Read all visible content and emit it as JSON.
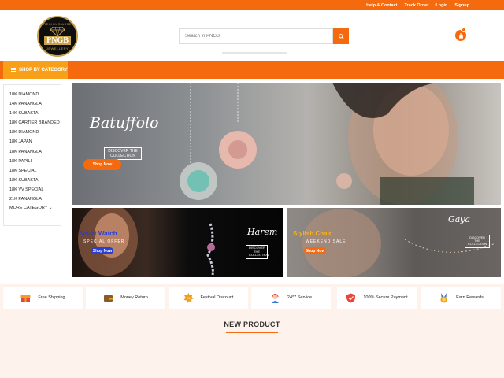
{
  "topbar": {
    "links": [
      "Help & Contact",
      "Track Order",
      "Login",
      "Signup"
    ]
  },
  "header": {
    "logo": {
      "brand": "PNGB",
      "ring_top": "PRECIOUS ASSET",
      "ring_bottom": "JEWELLERY"
    },
    "search_placeholder": "Search in PNGB",
    "cart_count": ""
  },
  "category_bar": {
    "label": "SHOP BY CATEGORY"
  },
  "sidebar": {
    "items": [
      "10K DIAMOND",
      "14K PANANGLA",
      "14K SUBASTA",
      "18K CARTIER BRANDED",
      "18K DIAMOND",
      "18K JAPAN",
      "18K PANANGLA",
      "18K PAPILI",
      "18K SPECIAL",
      "18K SUBASTA",
      "18K VV SPECIAL",
      "21K PANANGLA"
    ],
    "more": "MORE CATEGORY"
  },
  "main_banner": {
    "script": "Batuffolo",
    "discover": "DISCOVER THE COLLECTION",
    "button": "Shop Now"
  },
  "left_banner": {
    "title": "Smart Watch",
    "subtitle": "SPECIAL OFFER",
    "button": "Shop Now",
    "script": "Harem",
    "discover": "DISCOVER THE COLLECTION"
  },
  "right_banner": {
    "title": "Stylish Chair",
    "subtitle": "WEEKEND SALE",
    "button": "Shop Now",
    "script": "Gaya",
    "discover": "DISCOVER THE COLLECTION"
  },
  "features": [
    {
      "label": "Free Shipping",
      "icon": "gift-box-icon",
      "color": "#e8463c"
    },
    {
      "label": "Money Return",
      "icon": "wallet-icon",
      "color": "#8b5a2b"
    },
    {
      "label": "Festival Discount",
      "icon": "discount-badge-icon",
      "color": "#f0a020"
    },
    {
      "label": "24*7 Service",
      "icon": "support-agent-icon",
      "color": "#3a7bd5"
    },
    {
      "label": "100% Secure Payment",
      "icon": "shield-icon",
      "color": "#e8463c"
    },
    {
      "label": "Earn Rewards",
      "icon": "medal-icon",
      "color": "#f0a020"
    }
  ],
  "new_product": {
    "title": "NEW PRODUCT"
  },
  "colors": {
    "accent": "#f56a0e",
    "category_button": "#f9a01b",
    "feature_bg": "#fdf2ec"
  }
}
